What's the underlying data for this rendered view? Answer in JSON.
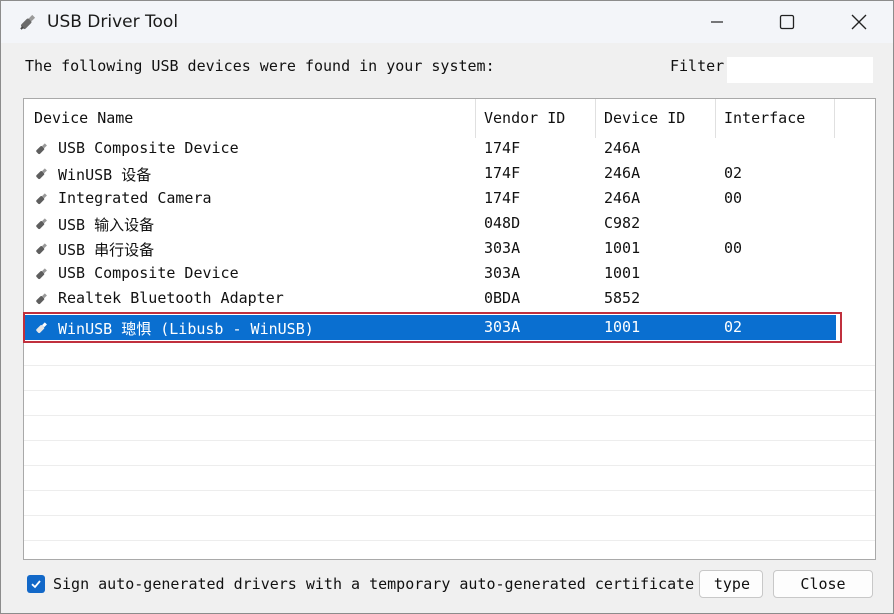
{
  "window": {
    "title": "USB Driver Tool"
  },
  "header": {
    "text": "The following USB devices were found in your system:",
    "filter_label": "Filter",
    "filter_value": ""
  },
  "columns": [
    "Device Name",
    "Vendor ID",
    "Device ID",
    "Interface"
  ],
  "rows": [
    {
      "name": "USB Composite Device",
      "vendor": "174F",
      "device": "246A",
      "iface": ""
    },
    {
      "name": "WinUSB 设备",
      "vendor": "174F",
      "device": "246A",
      "iface": "02"
    },
    {
      "name": "Integrated Camera",
      "vendor": "174F",
      "device": "246A",
      "iface": "00"
    },
    {
      "name": "USB 输入设备",
      "vendor": "048D",
      "device": "C982",
      "iface": ""
    },
    {
      "name": "USB 串行设备",
      "vendor": "303A",
      "device": "1001",
      "iface": "00"
    },
    {
      "name": "USB Composite Device",
      "vendor": "303A",
      "device": "1001",
      "iface": ""
    },
    {
      "name": "Realtek Bluetooth Adapter",
      "vendor": "0BDA",
      "device": "5852",
      "iface": ""
    },
    {
      "name": "WinUSB 璁惧   (Libusb - WinUSB)",
      "vendor": "303A",
      "device": "1001",
      "iface": "02",
      "selected": true
    }
  ],
  "footer": {
    "sign_checkbox_label": "Sign auto-generated drivers with a temporary auto-generated certificate",
    "sign_checked": true,
    "type_button": "type",
    "close_button": "Close"
  },
  "colors": {
    "selection": "#0a6fd0",
    "highlight_outline": "#c0303d",
    "checkbox": "#1268c8"
  }
}
